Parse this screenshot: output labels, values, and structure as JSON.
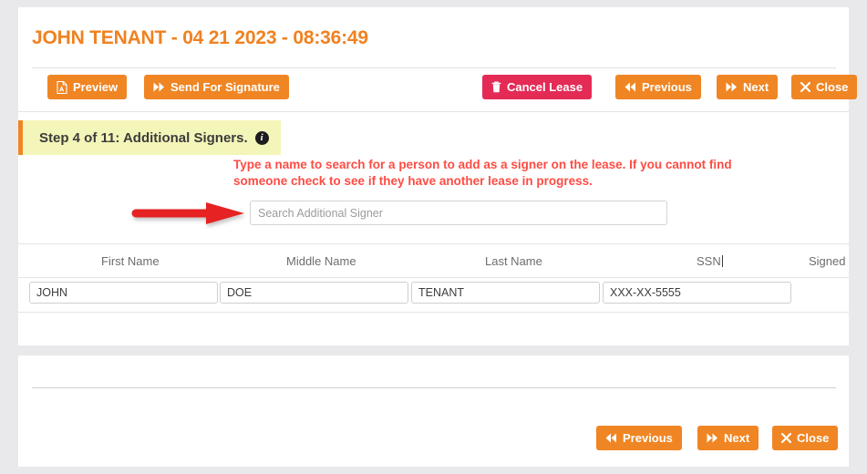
{
  "header": {
    "title": "JOHN TENANT - 04 21 2023 - 08:36:49"
  },
  "toolbar": {
    "preview_label": "Preview",
    "send_for_signature_label": "Send For Signature",
    "cancel_lease_label": "Cancel Lease",
    "previous_label": "Previous",
    "next_label": "Next",
    "close_label": "Close"
  },
  "step": {
    "label": "Step 4 of 11: Additional Signers.",
    "info_glyph": "i"
  },
  "instruction": {
    "text": "Type a name to search for a person to add as a signer on the lease.  If you cannot find someone check to see if they have another lease in progress."
  },
  "search": {
    "placeholder": "Search Additional Signer",
    "value": ""
  },
  "table": {
    "headers": {
      "first_name": "First Name",
      "middle_name": "Middle Name",
      "last_name": "Last Name",
      "ssn": "SSN",
      "signed": "Signed"
    },
    "rows": [
      {
        "first_name": "JOHN",
        "middle_name": "DOE",
        "last_name": "TENANT",
        "ssn": "XXX-XX-5555",
        "signed": ""
      }
    ]
  },
  "footer": {
    "previous_label": "Previous",
    "next_label": "Next",
    "close_label": "Close"
  },
  "colors": {
    "accent_orange": "#f08523",
    "title_orange": "#f08120",
    "danger_pink": "#e32b56",
    "instruction_red": "#fd4c44",
    "step_yellow": "#f4f5b8",
    "annotation_red": "#e62222",
    "page_background": "#e9e9eb"
  },
  "icons": {
    "pdf": "pdf-file-icon",
    "fast_forward": "double-chevron-right-icon",
    "rewind": "double-chevron-left-icon",
    "trash": "trash-icon",
    "close": "close-x-icon",
    "info": "info-circle-icon",
    "arrow_annotation": "right-arrow-annotation-icon"
  }
}
